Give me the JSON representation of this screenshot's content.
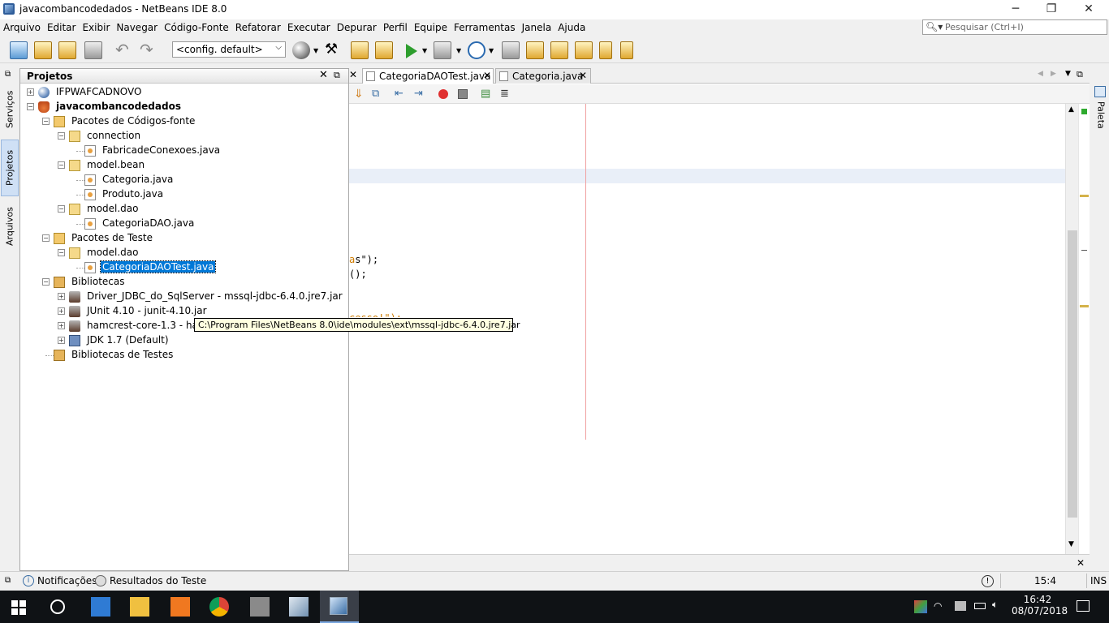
{
  "window": {
    "title": "javacombancodedados - NetBeans IDE 8.0",
    "minimize": "─",
    "restore": "❐",
    "close": "✕"
  },
  "menubar": {
    "items": [
      "Arquivo",
      "Editar",
      "Exibir",
      "Navegar",
      "Código-Fonte",
      "Refatorar",
      "Executar",
      "Depurar",
      "Perfil",
      "Equipe",
      "Ferramentas",
      "Janela",
      "Ajuda"
    ]
  },
  "search": {
    "placeholder": "Pesquisar (Ctrl+I)",
    "icon": "search-icon"
  },
  "toolbar": {
    "config_value": "<config. default>"
  },
  "left_strip": {
    "tabs": [
      "Serviços",
      "Projetos",
      "Arquivos"
    ]
  },
  "right_strip": {
    "tabs": [
      "Paleta"
    ]
  },
  "projects": {
    "title": "Projetos",
    "tree": [
      {
        "label": "IFPWAFCADNOVO",
        "level": 0,
        "icon": "globe-icon",
        "expanded": false,
        "bold": false
      },
      {
        "label": "javacombancodedados",
        "level": 0,
        "icon": "coffee-cup-icon",
        "expanded": true,
        "bold": true
      },
      {
        "label": "Pacotes de Códigos-fonte",
        "level": 1,
        "icon": "source-packages-icon",
        "expanded": true
      },
      {
        "label": "connection",
        "level": 2,
        "icon": "package-icon",
        "expanded": true
      },
      {
        "label": "FabricadeConexoes.java",
        "level": 3,
        "icon": "java-file-icon"
      },
      {
        "label": "model.bean",
        "level": 2,
        "icon": "package-icon",
        "expanded": true
      },
      {
        "label": "Categoria.java",
        "level": 3,
        "icon": "java-file-icon"
      },
      {
        "label": "Produto.java",
        "level": 3,
        "icon": "java-file-icon"
      },
      {
        "label": "model.dao",
        "level": 2,
        "icon": "package-icon",
        "expanded": true
      },
      {
        "label": "CategoriaDAO.java",
        "level": 3,
        "icon": "java-file-icon"
      },
      {
        "label": "Pacotes de Teste",
        "level": 1,
        "icon": "test-packages-icon",
        "expanded": true
      },
      {
        "label": "model.dao",
        "level": 2,
        "icon": "package-icon",
        "expanded": true
      },
      {
        "label": "CategoriaDAOTest.java",
        "level": 3,
        "icon": "java-file-icon",
        "selected": true
      },
      {
        "label": "Bibliotecas",
        "level": 1,
        "icon": "libraries-icon",
        "expanded": true
      },
      {
        "label": "Driver_JDBC_do_SqlServer - mssql-jdbc-6.4.0.jre7.jar",
        "level": 2,
        "icon": "jar-icon",
        "expanded": false
      },
      {
        "label": "JUnit 4.10 - junit-4.10.jar",
        "level": 2,
        "icon": "jar-icon",
        "expanded": false
      },
      {
        "label": "hamcrest-core-1.3 - hamcre",
        "level": 2,
        "icon": "jar-icon",
        "expanded": false
      },
      {
        "label": "JDK 1.7 (Default)",
        "level": 2,
        "icon": "jdk-icon",
        "expanded": false
      },
      {
        "label": "Bibliotecas de Testes",
        "level": 1,
        "icon": "test-libraries-icon"
      }
    ]
  },
  "tooltip": {
    "text": "C:\\Program Files\\NetBeans 8.0\\ide\\modules\\ext\\mssql-jdbc-6.4.0.jre7.jar"
  },
  "editor": {
    "tabs": [
      {
        "label": "CategoriaDAOTest.java",
        "active": true
      },
      {
        "label": "Categoria.java",
        "active": false
      }
    ],
    "code_fragments": [
      "s\");",
      "();",
      "cesso!\");"
    ]
  },
  "statusbar": {
    "notifications": "Notificações",
    "test_results": "Resultados do Teste",
    "position": "15:4",
    "mode": "INS"
  },
  "taskbar": {
    "time": "16:42",
    "date": "08/07/2018"
  },
  "colors": {
    "selection": "#0078d7",
    "current_line": "#e9eff8",
    "tooltip_bg": "#ffffe1",
    "taskbar_bg": "#0f1215"
  }
}
